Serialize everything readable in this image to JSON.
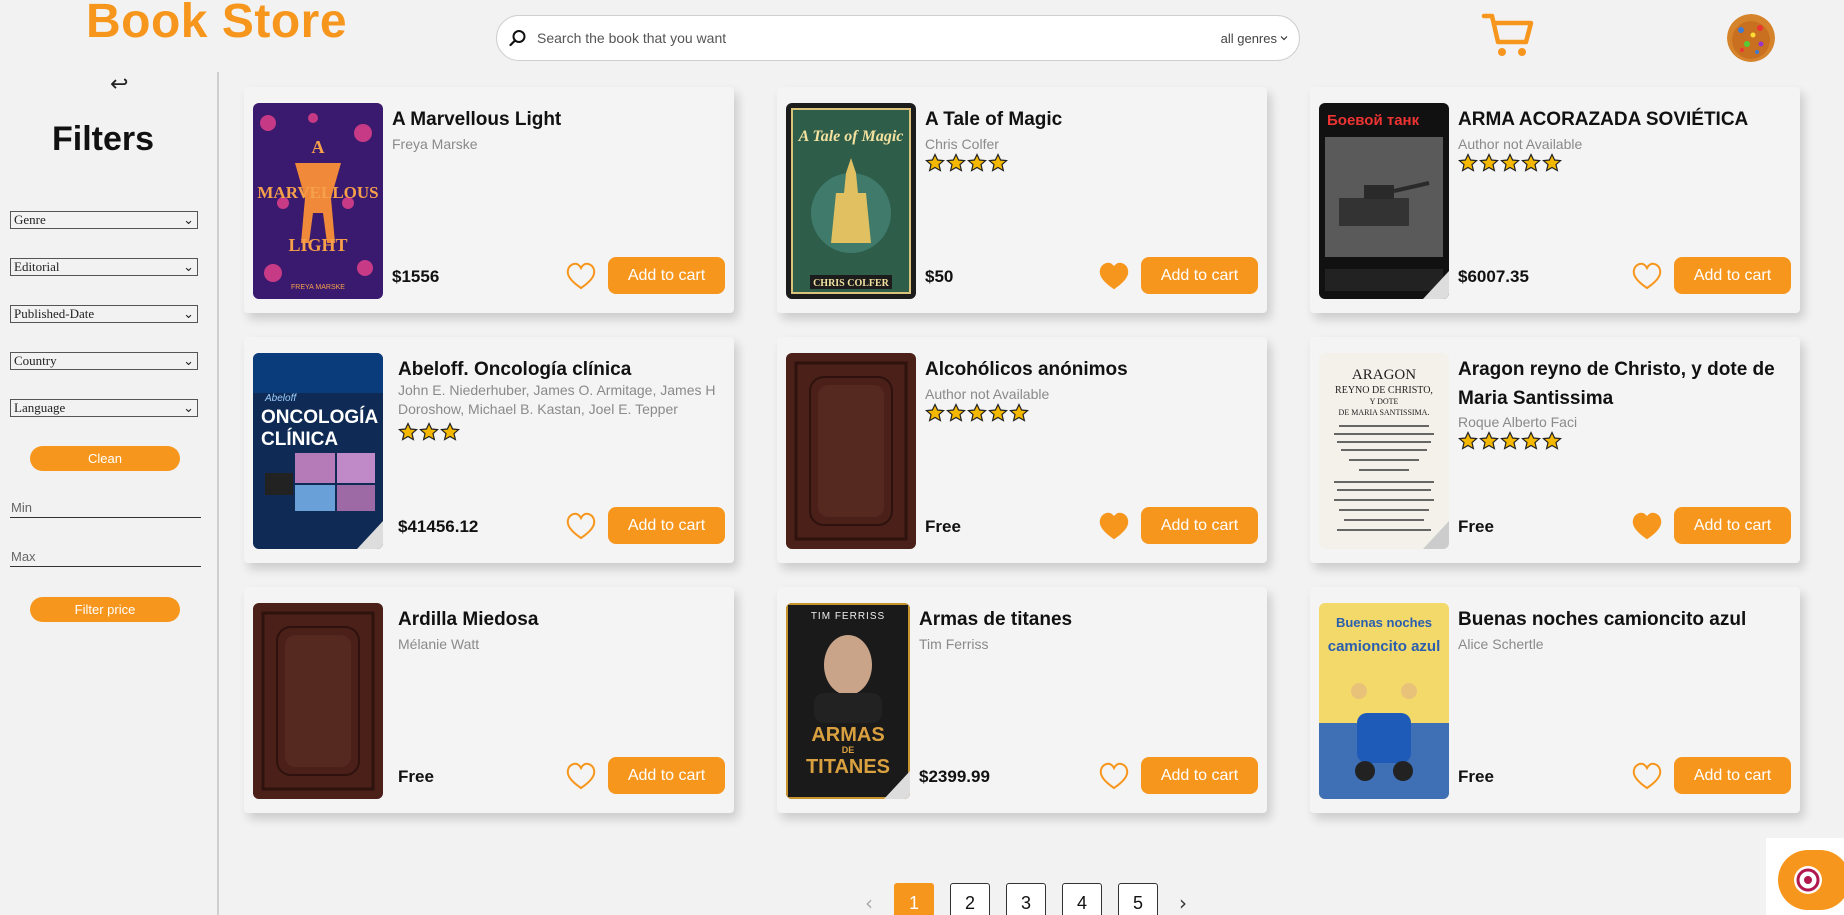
{
  "header": {
    "brand": "Book Store",
    "search_placeholder": "Search the book that you want",
    "genre_select": "all genres"
  },
  "sidebar": {
    "title": "Filters",
    "selects": [
      "Genre",
      "Editorial",
      "Published-Date",
      "Country",
      "Language"
    ],
    "clean_label": "Clean",
    "min_placeholder": "Min",
    "max_placeholder": "Max",
    "filter_price_label": "Filter price"
  },
  "books": [
    {
      "title": "A Marvellous Light",
      "author": "Freya Marske",
      "rating": 0,
      "price": "$1556",
      "favorite": false
    },
    {
      "title": "A Tale of Magic",
      "author": "Chris Colfer",
      "rating": 4,
      "price": "$50",
      "favorite": true
    },
    {
      "title": "ARMA ACORAZADA SOVIÉTICA",
      "author": "Author not Available",
      "rating": 5,
      "price": "$6007.35",
      "favorite": false
    },
    {
      "title": "Abeloff. Oncología clínica",
      "author": "John E. Niederhuber, James O. Armitage, James H Doroshow, Michael B. Kastan, Joel E. Tepper",
      "rating": 3,
      "price": "$41456.12",
      "favorite": false
    },
    {
      "title": "Alcohólicos anónimos",
      "author": "Author not Available",
      "rating": 5,
      "price": "Free",
      "favorite": true
    },
    {
      "title": "Aragon reyno de Christo, y dote de Maria Santissima",
      "author": "Roque Alberto Faci",
      "rating": 5,
      "price": "Free",
      "favorite": true
    },
    {
      "title": "Ardilla Miedosa",
      "author": "Mélanie Watt",
      "rating": 0,
      "price": "Free",
      "favorite": false
    },
    {
      "title": "Armas de titanes",
      "author": "Tim Ferriss",
      "rating": 0,
      "price": "$2399.99",
      "favorite": false
    },
    {
      "title": "Buenas noches camioncito azul",
      "author": "Alice Schertle",
      "rating": 0,
      "price": "Free",
      "favorite": false
    }
  ],
  "cover_texts": {
    "marvellous": [
      "A",
      "MARVELLOUS",
      "LIGHT",
      "FREYA MARSKE"
    ],
    "magic": [
      "A Tale of Magic",
      "CHRIS COLFER"
    ],
    "arma": [
      "Боевой танк"
    ],
    "oncologia": [
      "Abeloff",
      "ONCOLOGÍA",
      "CLÍNICA"
    ],
    "aragon": [
      "ARAGON",
      "REYNO DE CHRISTO,",
      "Y DOTE",
      "DE MARIA SANTISSIMA."
    ],
    "titanes": [
      "TIM FERRISS",
      "ARMAS",
      "DE",
      "TITANES"
    ],
    "camion": [
      "Buenas noches",
      "camioncito azul"
    ]
  },
  "add_to_cart_label": "Add to cart",
  "pagination": {
    "prev": "‹",
    "next": "›",
    "pages": [
      "1",
      "2",
      "3",
      "4",
      "5"
    ],
    "current": "1"
  },
  "colors": {
    "accent": "#f7961d",
    "star": "#f5b800"
  }
}
